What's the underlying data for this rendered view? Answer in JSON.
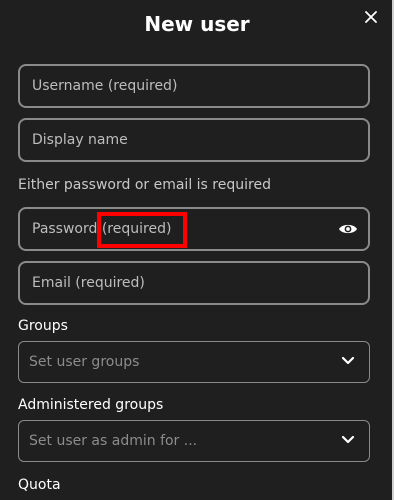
{
  "dialog": {
    "title": "New user",
    "close_icon": "close-icon"
  },
  "form": {
    "username": {
      "placeholder": "Username (required)",
      "value": ""
    },
    "display_name": {
      "placeholder": "Display name",
      "value": ""
    },
    "password_hint": "Either password or email is required",
    "password": {
      "placeholder": "Password (required)",
      "value": "",
      "toggle_icon": "eye-icon"
    },
    "email": {
      "placeholder": "Email (required)",
      "value": ""
    },
    "groups": {
      "label": "Groups",
      "placeholder": "Set user groups",
      "icon": "chevron-down-icon"
    },
    "admin_groups": {
      "label": "Administered groups",
      "placeholder": "Set user as admin for ...",
      "icon": "chevron-down-icon"
    },
    "quota": {
      "label": "Quota"
    }
  },
  "annotation": {
    "color": "#ff0000"
  },
  "colors": {
    "background": "#1f1f1f",
    "border": "#8a8a8a",
    "text": "#eaeaea"
  }
}
